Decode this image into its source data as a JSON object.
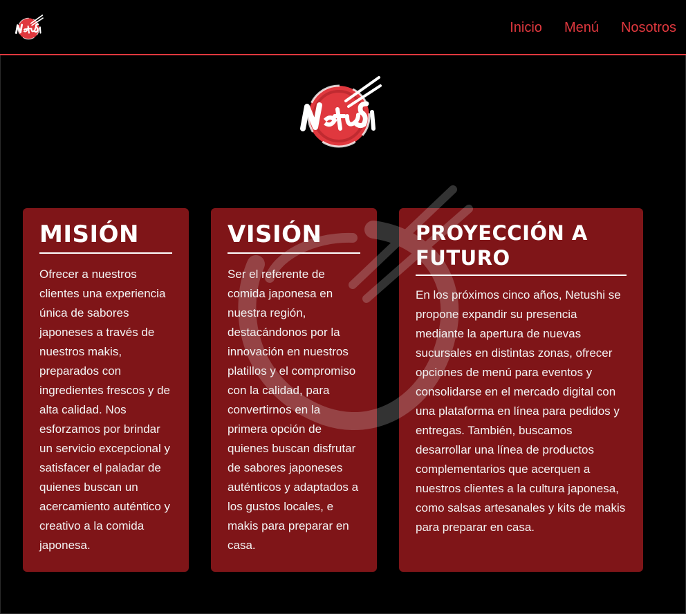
{
  "colors": {
    "background": "#000000",
    "accent": "#e0383e",
    "card": "#7f1518",
    "text": "#ffffff"
  },
  "header": {
    "logo_icon": "netushi-logo-icon",
    "nav": [
      {
        "label": "Inicio"
      },
      {
        "label": "Menú"
      },
      {
        "label": "Nosotros"
      }
    ]
  },
  "hero": {
    "logo_icon": "netushi-logo-icon"
  },
  "cards": [
    {
      "title": "MISIÓN",
      "text": "Ofrecer a nuestros clientes una experiencia única de sabores japoneses a través de nuestros makis, preparados con ingredientes frescos y de alta calidad. Nos esforzamos por brindar un servicio excepcional y satisfacer el paladar de quienes buscan un acercamiento auténtico y creativo a la comida japonesa."
    },
    {
      "title": "VISIÓN",
      "text": "Ser el referente de comida japonesa en nuestra región, destacándonos por la innovación en nuestros platillos y el compromiso con la calidad, para convertirnos en la primera opción de quienes buscan disfrutar de sabores japoneses auténticos y adaptados a los gustos locales, e makis para preparar en casa."
    },
    {
      "title": "PROYECCIÓN A FUTURO",
      "text": "En los próximos cinco años, Netushi se propone expandir su presencia mediante la apertura de nuevas sucursales en distintas zonas, ofrecer opciones de menú para eventos y consolidarse en el mercado digital con una plataforma en línea para pedidos y entregas. También, buscamos desarrollar una línea de productos complementarios que acerquen a nuestros clientes a la cultura japonesa, como salsas artesanales y kits de makis para preparar en casa."
    }
  ]
}
